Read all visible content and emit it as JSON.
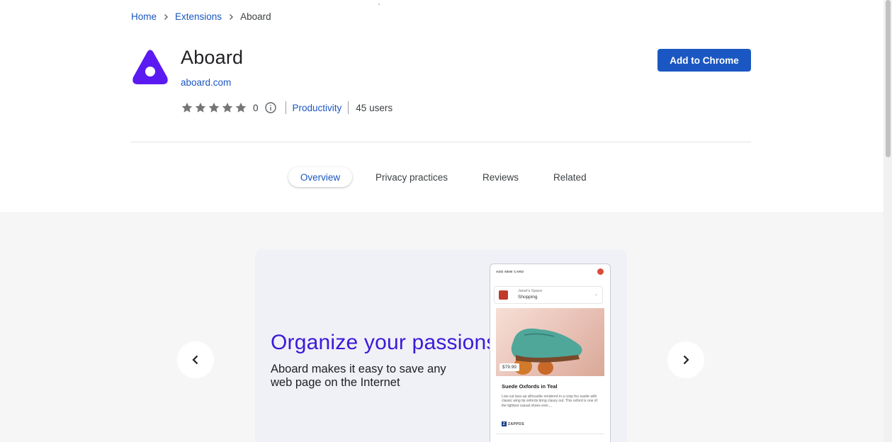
{
  "breadcrumb": {
    "home": "Home",
    "extensions": "Extensions",
    "current": "Aboard"
  },
  "extension": {
    "name": "Aboard",
    "site": "aboard.com",
    "rating_value": 0,
    "rating_count": "0",
    "category": "Productivity",
    "users": "45 users",
    "logo_icon": "aboard-logo",
    "logo_color": "#5b1af2"
  },
  "actions": {
    "add_button": "Add to Chrome",
    "add_button_color": "#1a57c2"
  },
  "tabs": [
    {
      "label": "Overview",
      "active": true
    },
    {
      "label": "Privacy practices",
      "active": false
    },
    {
      "label": "Reviews",
      "active": false
    },
    {
      "label": "Related",
      "active": false
    }
  ],
  "gallery": {
    "prev_icon": "chevron-left-icon",
    "next_icon": "chevron-right-icon",
    "slide": {
      "heading": "Organize your passions.",
      "subtext": "Aboard makes it easy to save any web page on the Internet",
      "heading_color": "#3b1ad8",
      "phone": {
        "header": "ADD NEW CARD",
        "space_label": "Janet's Space",
        "collection": "Shopping",
        "price": "$79.99",
        "card_title": "Suede Oxfords in Teal",
        "card_body": "Low-cut lace-up silhouette rendered in a crisp fox suede with classic wing tip oxfords bring classy out. This oxford is one of the lightest casual shoes ever....",
        "brand": "ZAPPOS"
      }
    }
  },
  "colors": {
    "link": "#1a57c2",
    "gallery_bg": "#f6f6f7"
  }
}
